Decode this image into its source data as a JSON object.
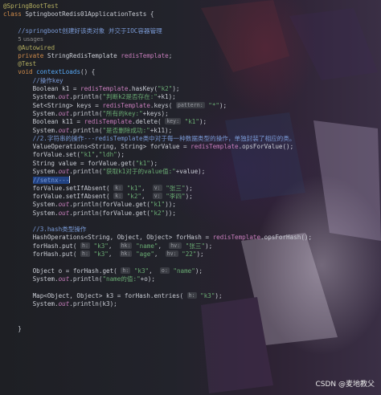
{
  "editor": {
    "lines": [
      {
        "segs": [
          {
            "c": "ann",
            "t": "@SpringBootTest"
          }
        ]
      },
      {
        "segs": [
          {
            "c": "kw",
            "t": "class "
          },
          {
            "c": "",
            "t": "SptingbootRedis01ApplicationTests {"
          }
        ]
      },
      {
        "segs": []
      },
      {
        "segs": [
          {
            "c": "",
            "t": "    "
          },
          {
            "c": "cm",
            "t": "//springboot创建好该类对象 并交于IOC容器管理"
          }
        ]
      },
      {
        "segs": [
          {
            "c": "",
            "t": "    "
          },
          {
            "c": "usage",
            "t": "5 usages"
          }
        ]
      },
      {
        "segs": [
          {
            "c": "",
            "t": "    "
          },
          {
            "c": "ann",
            "t": "@Autowired"
          }
        ]
      },
      {
        "segs": [
          {
            "c": "",
            "t": "    "
          },
          {
            "c": "kw",
            "t": "private "
          },
          {
            "c": "",
            "t": "StringRedisTemplate "
          },
          {
            "c": "fld",
            "t": "redisTemplate"
          },
          {
            "c": "",
            "t": ";"
          }
        ]
      },
      {
        "segs": [
          {
            "c": "",
            "t": "    "
          },
          {
            "c": "ann",
            "t": "@Test"
          }
        ]
      },
      {
        "segs": [
          {
            "c": "",
            "t": "    "
          },
          {
            "c": "kw",
            "t": "void "
          },
          {
            "c": "fn",
            "t": "contextLoads"
          },
          {
            "c": "",
            "t": "() {"
          }
        ]
      },
      {
        "segs": [
          {
            "c": "",
            "t": "        "
          },
          {
            "c": "cm",
            "t": "//操作key"
          }
        ]
      },
      {
        "segs": [
          {
            "c": "",
            "t": "        Boolean k1 = "
          },
          {
            "c": "fld",
            "t": "redisTemplate"
          },
          {
            "c": "",
            "t": ".hasKey("
          },
          {
            "c": "str",
            "t": "\"k2\""
          },
          {
            "c": "",
            "t": ");"
          }
        ]
      },
      {
        "segs": [
          {
            "c": "",
            "t": "        System."
          },
          {
            "c": "it",
            "t": "out"
          },
          {
            "c": "",
            "t": ".println("
          },
          {
            "c": "str",
            "t": "\"判断k2是否存在:\""
          },
          {
            "c": "",
            "t": "+k1);"
          }
        ]
      },
      {
        "segs": [
          {
            "c": "",
            "t": "        Set<String> keys = "
          },
          {
            "c": "fld",
            "t": "redisTemplate"
          },
          {
            "c": "",
            "t": ".keys( "
          },
          {
            "c": "hint",
            "t": "pattern:"
          },
          {
            "c": "",
            "t": " "
          },
          {
            "c": "str",
            "t": "\"*\""
          },
          {
            "c": "",
            "t": ");"
          }
        ]
      },
      {
        "segs": [
          {
            "c": "",
            "t": "        System."
          },
          {
            "c": "it",
            "t": "out"
          },
          {
            "c": "",
            "t": ".println("
          },
          {
            "c": "str",
            "t": "\"所有的key:\""
          },
          {
            "c": "",
            "t": "+keys);"
          }
        ]
      },
      {
        "segs": [
          {
            "c": "",
            "t": "        Boolean k11 = "
          },
          {
            "c": "fld",
            "t": "redisTemplate"
          },
          {
            "c": "",
            "t": ".delete( "
          },
          {
            "c": "hint",
            "t": "key:"
          },
          {
            "c": "",
            "t": " "
          },
          {
            "c": "str",
            "t": "\"k1\""
          },
          {
            "c": "",
            "t": ");"
          }
        ]
      },
      {
        "segs": [
          {
            "c": "",
            "t": "        System."
          },
          {
            "c": "it",
            "t": "out"
          },
          {
            "c": "",
            "t": ".println("
          },
          {
            "c": "str",
            "t": "\"是否删除成功:\""
          },
          {
            "c": "",
            "t": "+k11);"
          }
        ]
      },
      {
        "segs": [
          {
            "c": "",
            "t": "        "
          },
          {
            "c": "cm",
            "t": "//2.字符串的操作---redisTemplate类中对于每一种数据类型的操作，单独封装了相应的类。"
          }
        ]
      },
      {
        "segs": [
          {
            "c": "",
            "t": "        ValueOperations<String, String> forValue = "
          },
          {
            "c": "fld",
            "t": "redisTemplate"
          },
          {
            "c": "",
            "t": ".opsForValue();"
          }
        ]
      },
      {
        "segs": [
          {
            "c": "",
            "t": "        forValue.set("
          },
          {
            "c": "str",
            "t": "\"k1\""
          },
          {
            "c": "",
            "t": ","
          },
          {
            "c": "str",
            "t": "\"ldh\""
          },
          {
            "c": "",
            "t": ");"
          }
        ]
      },
      {
        "segs": [
          {
            "c": "",
            "t": "        String value = forValue.get("
          },
          {
            "c": "str",
            "t": "\"k1\""
          },
          {
            "c": "",
            "t": ");"
          }
        ]
      },
      {
        "segs": [
          {
            "c": "",
            "t": "        System."
          },
          {
            "c": "it",
            "t": "out"
          },
          {
            "c": "",
            "t": ".println("
          },
          {
            "c": "str",
            "t": "\"获取k1对于的value值:\""
          },
          {
            "c": "",
            "t": "+value);"
          }
        ]
      },
      {
        "segs": [
          {
            "c": "",
            "t": "        "
          },
          {
            "c": "cm sel",
            "t": "//setnx---"
          },
          {
            "c": "caret",
            "t": ""
          }
        ]
      },
      {
        "segs": [
          {
            "c": "",
            "t": "        forValue.setIfAbsent( "
          },
          {
            "c": "hint",
            "t": "k:"
          },
          {
            "c": "",
            "t": " "
          },
          {
            "c": "str",
            "t": "\"k1\""
          },
          {
            "c": "",
            "t": ",  "
          },
          {
            "c": "hint",
            "t": "v:"
          },
          {
            "c": "",
            "t": " "
          },
          {
            "c": "str",
            "t": "\"张三\""
          },
          {
            "c": "",
            "t": ");"
          }
        ]
      },
      {
        "segs": [
          {
            "c": "",
            "t": "        forValue.setIfAbsent( "
          },
          {
            "c": "hint",
            "t": "k:"
          },
          {
            "c": "",
            "t": " "
          },
          {
            "c": "str",
            "t": "\"k2\""
          },
          {
            "c": "",
            "t": ",  "
          },
          {
            "c": "hint",
            "t": "v:"
          },
          {
            "c": "",
            "t": " "
          },
          {
            "c": "str",
            "t": "\"李四\""
          },
          {
            "c": "",
            "t": ");"
          }
        ]
      },
      {
        "segs": [
          {
            "c": "",
            "t": "        System."
          },
          {
            "c": "it",
            "t": "out"
          },
          {
            "c": "",
            "t": ".println(forValue.get("
          },
          {
            "c": "str",
            "t": "\"k1\""
          },
          {
            "c": "",
            "t": "));"
          }
        ]
      },
      {
        "segs": [
          {
            "c": "",
            "t": "        System."
          },
          {
            "c": "it",
            "t": "out"
          },
          {
            "c": "",
            "t": ".println(forValue.get("
          },
          {
            "c": "str",
            "t": "\"k2\""
          },
          {
            "c": "",
            "t": "));"
          }
        ]
      },
      {
        "segs": []
      },
      {
        "segs": [
          {
            "c": "",
            "t": "        "
          },
          {
            "c": "cm",
            "t": "//3.hash类型操作"
          }
        ]
      },
      {
        "segs": [
          {
            "c": "",
            "t": "        HashOperations<String, Object, Object> forHash = "
          },
          {
            "c": "fld",
            "t": "redisTemplate"
          },
          {
            "c": "",
            "t": ".opsForHash();"
          }
        ]
      },
      {
        "segs": [
          {
            "c": "",
            "t": "        forHash.put( "
          },
          {
            "c": "hint",
            "t": "h:"
          },
          {
            "c": "",
            "t": " "
          },
          {
            "c": "str",
            "t": "\"k3\""
          },
          {
            "c": "",
            "t": ",  "
          },
          {
            "c": "hint",
            "t": "hk:"
          },
          {
            "c": "",
            "t": " "
          },
          {
            "c": "str",
            "t": "\"name\""
          },
          {
            "c": "",
            "t": ",  "
          },
          {
            "c": "hint",
            "t": "hv:"
          },
          {
            "c": "",
            "t": " "
          },
          {
            "c": "str",
            "t": "\"张三\""
          },
          {
            "c": "",
            "t": ");"
          }
        ]
      },
      {
        "segs": [
          {
            "c": "",
            "t": "        forHash.put( "
          },
          {
            "c": "hint",
            "t": "h:"
          },
          {
            "c": "",
            "t": " "
          },
          {
            "c": "str",
            "t": "\"k3\""
          },
          {
            "c": "",
            "t": ",  "
          },
          {
            "c": "hint",
            "t": "hk:"
          },
          {
            "c": "",
            "t": " "
          },
          {
            "c": "str",
            "t": "\"age\""
          },
          {
            "c": "",
            "t": ",  "
          },
          {
            "c": "hint",
            "t": "hv:"
          },
          {
            "c": "",
            "t": " "
          },
          {
            "c": "str",
            "t": "\"22\""
          },
          {
            "c": "",
            "t": ");"
          }
        ]
      },
      {
        "segs": []
      },
      {
        "segs": [
          {
            "c": "",
            "t": "        Object o = forHash.get( "
          },
          {
            "c": "hint",
            "t": "h:"
          },
          {
            "c": "",
            "t": " "
          },
          {
            "c": "str",
            "t": "\"k3\""
          },
          {
            "c": "",
            "t": ",  "
          },
          {
            "c": "hint",
            "t": "o:"
          },
          {
            "c": "",
            "t": " "
          },
          {
            "c": "str",
            "t": "\"name\""
          },
          {
            "c": "",
            "t": ");"
          }
        ]
      },
      {
        "segs": [
          {
            "c": "",
            "t": "        System."
          },
          {
            "c": "it",
            "t": "out"
          },
          {
            "c": "",
            "t": ".println("
          },
          {
            "c": "str",
            "t": "\"name的值:\""
          },
          {
            "c": "",
            "t": "+o);"
          }
        ]
      },
      {
        "segs": []
      },
      {
        "segs": [
          {
            "c": "",
            "t": "        Map<Object, Object> k3 = forHash.entries( "
          },
          {
            "c": "hint",
            "t": "h:"
          },
          {
            "c": "",
            "t": " "
          },
          {
            "c": "str",
            "t": "\"k3\""
          },
          {
            "c": "",
            "t": ");"
          }
        ]
      },
      {
        "segs": [
          {
            "c": "",
            "t": "        System."
          },
          {
            "c": "it",
            "t": "out"
          },
          {
            "c": "",
            "t": ".println(k3);"
          }
        ]
      },
      {
        "segs": []
      },
      {
        "segs": []
      },
      {
        "segs": [
          {
            "c": "",
            "t": "    }"
          }
        ]
      }
    ]
  },
  "watermark": "CSDN @麦地教父",
  "colors": {
    "background": "#1e1f24",
    "keyword": "#d08c4b",
    "annotation": "#b3ae60",
    "string": "#6aab73",
    "comment": "#7a9ad6",
    "field": "#c77dbb",
    "method": "#56a8f5"
  }
}
